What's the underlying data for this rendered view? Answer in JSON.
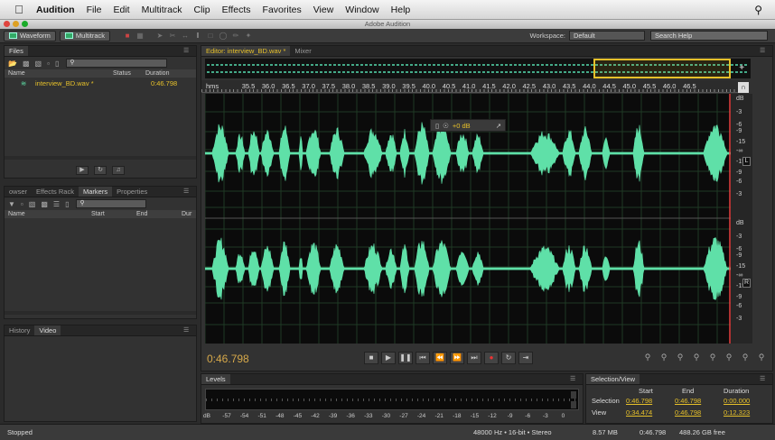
{
  "menubar": {
    "app": "Audition",
    "items": [
      "File",
      "Edit",
      "Multitrack",
      "Clip",
      "Effects",
      "Favorites",
      "View",
      "Window",
      "Help"
    ]
  },
  "window": {
    "title": "Adobe Audition"
  },
  "toolbar": {
    "waveform_label": "Waveform",
    "multitrack_label": "Multitrack",
    "workspace_label": "Workspace:",
    "workspace_value": "Default",
    "search_placeholder": "Search Help"
  },
  "files_panel": {
    "tab": "Files",
    "columns": {
      "name": "Name",
      "status": "Status",
      "duration": "Duration"
    },
    "items": [
      {
        "name": "interview_BD.wav *",
        "duration": "0:46.798"
      }
    ]
  },
  "markers_panel": {
    "tabs": [
      "owser",
      "Effects Rack",
      "Markers",
      "Properties"
    ],
    "active_tab": "Markers",
    "columns": {
      "name": "Name",
      "start": "Start",
      "end": "End",
      "duration": "Dur"
    }
  },
  "history_panel": {
    "tabs": [
      "History",
      "Video"
    ]
  },
  "editor": {
    "tabs": [
      "Editor: interview_BD.wav *",
      "Mixer"
    ],
    "ruler_unit": "hms",
    "ruler_ticks": [
      "35.5",
      "36.0",
      "36.5",
      "37.0",
      "37.5",
      "38.0",
      "38.5",
      "39.0",
      "39.5",
      "40.0",
      "40.5",
      "41.0",
      "41.5",
      "42.0",
      "42.5",
      "43.0",
      "43.5",
      "44.0",
      "44.5",
      "45.0",
      "45.5",
      "46.0",
      "46.5"
    ],
    "db_unit": "dB",
    "db_labels_ch1": [
      "-3",
      "-6",
      "-9",
      "-15",
      "-∞",
      "-15",
      "-9",
      "-6",
      "-3"
    ],
    "db_labels_ch2": [
      "-3",
      "-6",
      "-9",
      "-15",
      "-∞",
      "-15",
      "-9",
      "-6",
      "-3"
    ],
    "channel_labels": [
      "L",
      "R"
    ],
    "hud_gain": "+0 dB",
    "current_time": "0:46.798",
    "waveform_color": "#5fe0a8"
  },
  "levels_panel": {
    "tab": "Levels",
    "scale_unit": "dB",
    "scale": [
      "-57",
      "-54",
      "-51",
      "-48",
      "-45",
      "-42",
      "-39",
      "-36",
      "-33",
      "-30",
      "-27",
      "-24",
      "-21",
      "-18",
      "-15",
      "-12",
      "-9",
      "-6",
      "-3",
      "0"
    ]
  },
  "selection_view": {
    "tab": "Selection/View",
    "headers": {
      "start": "Start",
      "end": "End",
      "duration": "Duration"
    },
    "selection": {
      "label": "Selection",
      "start": "0:46.798",
      "end": "0:46.798",
      "duration": "0:00.000"
    },
    "view": {
      "label": "View",
      "start": "0:34.474",
      "end": "0:46.798",
      "duration": "0:12.323"
    }
  },
  "statusbar": {
    "status": "Stopped",
    "format": "48000 Hz • 16-bit • Stereo",
    "size": "8.57 MB",
    "duration": "0:46.798",
    "free": "488.26 GB free"
  }
}
